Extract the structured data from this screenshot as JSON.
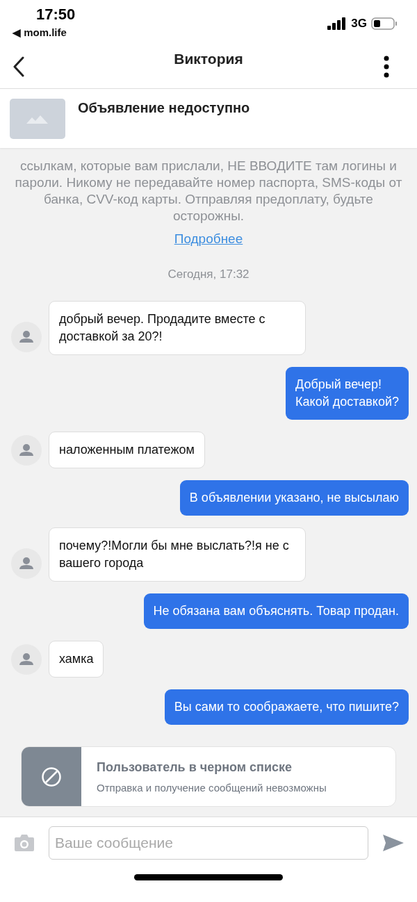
{
  "status_bar": {
    "time": "17:50",
    "back_app": "◀ mom.life",
    "network": "3G"
  },
  "header": {
    "title": "Виктория"
  },
  "listing": {
    "title": "Объявление недоступно",
    "kind": "picture"
  },
  "warning": {
    "text": "ссылкам, которые вам прислали, НЕ ВВОДИТЕ там логины и пароли. Никому не передавайте номер паспорта, SMS-коды от банка, CVV-код карты. Отправляя предоплату, будьте осторожны.",
    "link": "Подробнее"
  },
  "date": "Сегодня, 17:32",
  "messages": [
    {
      "incoming": true,
      "text": "добрый вечер. Продадите вместе с доставкой за 20?!"
    },
    {
      "incoming": false,
      "text": "Добрый вечер!\nКакой доставкой?"
    },
    {
      "incoming": true,
      "text": "наложенным платежом"
    },
    {
      "incoming": false,
      "text": "В объявлении указано, не высылаю"
    },
    {
      "incoming": true,
      "text": "почему?!Могли бы мне выслать?!я не с вашего города"
    },
    {
      "incoming": false,
      "text": "Не обязана вам объяснять.  Товар продан."
    },
    {
      "incoming": true,
      "text": "хамка"
    },
    {
      "incoming": false,
      "text": "Вы сами то соображаете, что пишите?"
    }
  ],
  "blocked": {
    "title": "Пользователь в черном списке",
    "subtitle": "Отправка и получение сообщений невозможны"
  },
  "composer": {
    "placeholder": "Ваше сообщение"
  }
}
